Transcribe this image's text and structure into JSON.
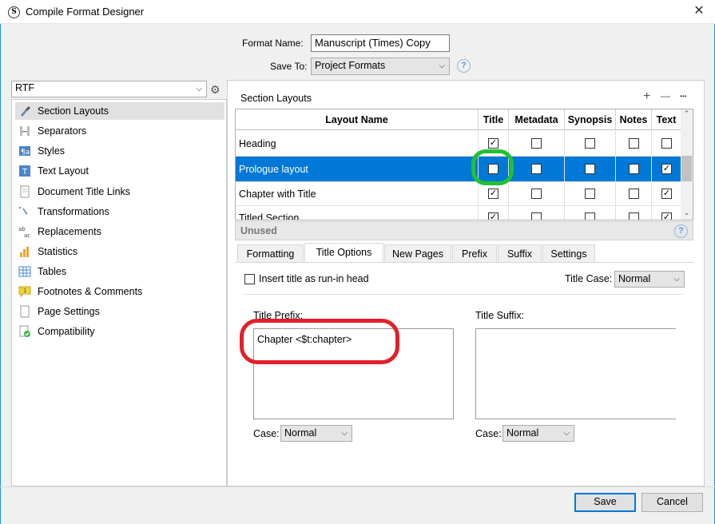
{
  "window": {
    "title": "Compile Format Designer",
    "app_icon_text": "S",
    "close_glyph": "✕"
  },
  "header": {
    "format_name_label": "Format Name:",
    "format_name_value": "Manuscript (Times) Copy",
    "save_to_label": "Save To:",
    "save_to_value": "Project Formats",
    "help_glyph": "?"
  },
  "sidebar": {
    "format_select": "RTF",
    "items": [
      {
        "label": "Section Layouts",
        "icon": "brush-icon",
        "selected": true
      },
      {
        "label": "Separators",
        "icon": "separator-icon"
      },
      {
        "label": "Styles",
        "icon": "styles-icon"
      },
      {
        "label": "Text Layout",
        "icon": "text-layout-icon"
      },
      {
        "label": "Document Title Links",
        "icon": "document-links-icon"
      },
      {
        "label": "Transformations",
        "icon": "transform-icon"
      },
      {
        "label": "Replacements",
        "icon": "replace-icon"
      },
      {
        "label": "Statistics",
        "icon": "bar-chart-icon"
      },
      {
        "label": "Tables",
        "icon": "table-icon"
      },
      {
        "label": "Footnotes & Comments",
        "icon": "comment-icon"
      },
      {
        "label": "Page Settings",
        "icon": "page-icon"
      },
      {
        "label": "Compatibility",
        "icon": "compat-icon"
      }
    ]
  },
  "section_layouts": {
    "title": "Section Layouts",
    "add_glyph": "+",
    "remove_glyph": "—",
    "more_glyph": "•••",
    "columns": [
      "Layout Name",
      "Title",
      "Metadata",
      "Synopsis",
      "Notes",
      "Text"
    ],
    "rows": [
      {
        "name": "Heading",
        "checks": [
          true,
          false,
          false,
          false,
          false
        ],
        "selected": false
      },
      {
        "name": "Prologue layout",
        "checks": [
          false,
          false,
          false,
          false,
          true
        ],
        "selected": true
      },
      {
        "name": "Chapter with Title",
        "checks": [
          true,
          false,
          false,
          false,
          true
        ],
        "selected": false
      },
      {
        "name": "Titled Section",
        "checks": [
          true,
          false,
          false,
          false,
          true
        ],
        "selected": false
      }
    ],
    "unused_label": "Unused"
  },
  "tabs": [
    "Formatting",
    "Title Options",
    "New Pages",
    "Prefix",
    "Suffix",
    "Settings"
  ],
  "active_tab": "Title Options",
  "title_options": {
    "run_in_label": "Insert title as run-in head",
    "title_case_label": "Title Case:",
    "title_case_value": "Normal",
    "prefix_label": "Title Prefix:",
    "prefix_value": "Chapter <$t:chapter>",
    "suffix_label": "Title Suffix:",
    "suffix_value": "",
    "case_label": "Case:",
    "prefix_case_value": "Normal",
    "suffix_case_value": "Normal"
  },
  "footer": {
    "save": "Save",
    "cancel": "Cancel"
  },
  "colors": {
    "selection": "#0078d7",
    "highlight_red": "#e0202a",
    "highlight_green": "#21c132"
  }
}
